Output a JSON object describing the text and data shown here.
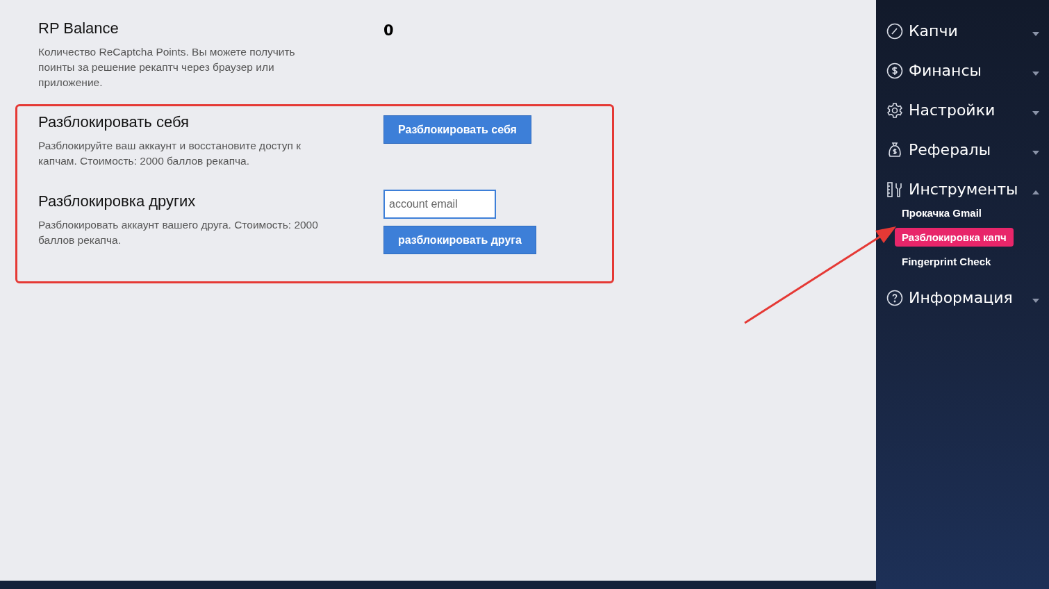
{
  "balance": {
    "title": "RP Balance",
    "description": "Количество ReCaptcha Points. Вы можете получить поинты за решение рекаптч через браузер или приложение.",
    "value": "0"
  },
  "unlock_self": {
    "title": "Разблокировать себя",
    "description": "Разблокируйте ваш аккаунт и восстановите доступ к капчам. Стоимость: 2000 баллов рекапча.",
    "button": "Разблокировать себя"
  },
  "unlock_others": {
    "title": "Разблокировка других",
    "description": "Разблокировать аккаунт вашего друга. Стоимость: 2000 баллов рекапча.",
    "email_field": {
      "placeholder": "account email"
    },
    "button": "разблокировать друга"
  },
  "sidebar": {
    "items": [
      {
        "label": "Капчи",
        "expanded": false
      },
      {
        "label": "Финансы",
        "expanded": false
      },
      {
        "label": "Настройки",
        "expanded": false
      },
      {
        "label": "Рефералы",
        "expanded": false
      },
      {
        "label": "Инструменты",
        "expanded": true,
        "children": [
          {
            "label": "Прокачка Gmail",
            "selected": false
          },
          {
            "label": "Разблокировка капч",
            "selected": true
          },
          {
            "label": "Fingerprint Check",
            "selected": false
          }
        ]
      },
      {
        "label": "Информация",
        "expanded": false
      }
    ]
  }
}
